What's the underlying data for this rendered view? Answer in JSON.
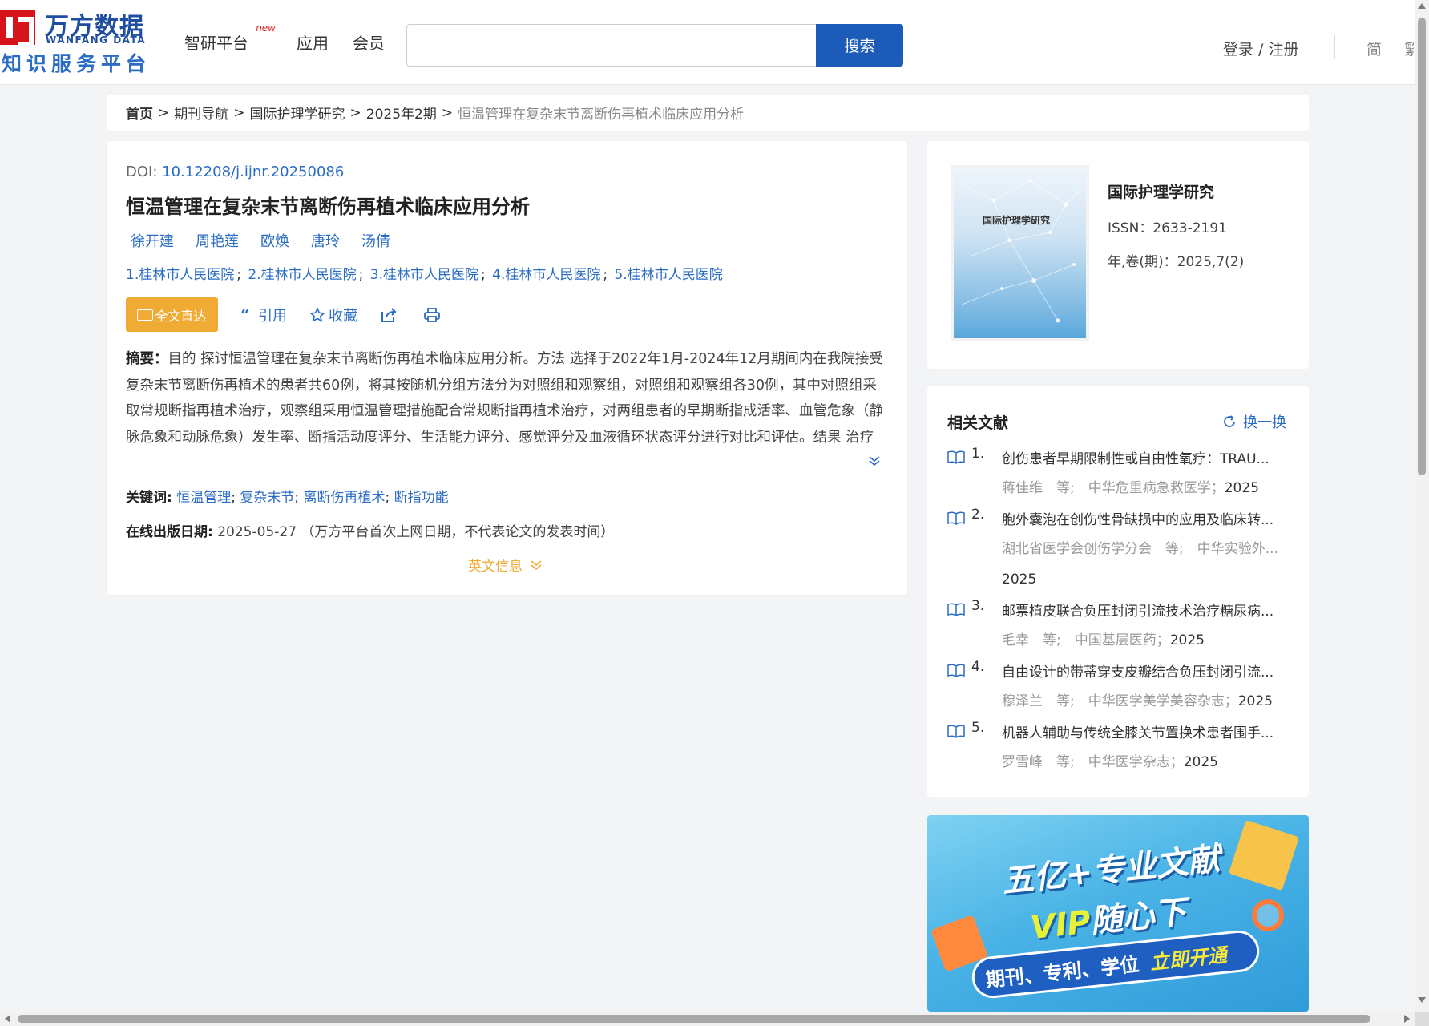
{
  "header": {
    "logo_cn": "万方数据",
    "logo_en": "WANFANG DATA",
    "logo_sub": "知识服务平台",
    "nav": [
      {
        "label": "智研平台",
        "badge": "new"
      },
      {
        "label": "应用"
      },
      {
        "label": "会员"
      }
    ],
    "search_value": "",
    "search_button": "搜索",
    "login": "登录 / 注册",
    "lang_simplified": "简",
    "lang_traditional": "繁"
  },
  "breadcrumb": [
    "首页",
    "期刊导航",
    "国际护理学研究",
    "2025年2期",
    "恒温管理在复杂末节离断伤再植术临床应用分析"
  ],
  "article": {
    "doi_label": "DOI:",
    "doi": "10.12208/j.ijnr.20250086",
    "title": "恒温管理在复杂末节离断伤再植术临床应用分析",
    "authors": [
      "徐开建",
      "周艳莲",
      "欧焕",
      "唐玲",
      "汤倩"
    ],
    "affiliations": [
      "1.桂林市人民医院",
      "2.桂林市人民医院",
      "3.桂林市人民医院",
      "4.桂林市人民医院",
      "5.桂林市人民医院"
    ],
    "actions": {
      "fulltext": "全文直达",
      "cite": "引用",
      "favorite": "收藏"
    },
    "abstract_label": "摘要：",
    "abstract": "目的 探讨恒温管理在复杂末节离断伤再植术临床应用分析。方法 选择于2022年1月-2024年12月期间内在我院接受复杂末节离断伤再植术的患者共60例，将其按随机分组方法分为对照组和观察组，对照组和观察组各30例，其中对照组采取常规断指再植术治疗，观察组采用恒温管理措施配合常规断指再植术治疗，对两组患者的早期断指成活率、血管危象（静脉危象和动脉危象）发生率、断指活动度评分、生活能力评分、感觉评分及血液循环状态评分进行对比和评估。结果 治疗后，观察组和对照组的早期断指成活率差异无统计学意义（P>0.05）。观察组患者的静脉危象和动脉危象发生率均低于...",
    "keywords_label": "关键词:",
    "keywords": [
      "恒温管理",
      "复杂末节",
      "离断伤再植术",
      "断指功能"
    ],
    "pubdate_label": "在线出版日期:",
    "pubdate": "2025-05-27",
    "pubdate_note": "（万方平台首次上网日期，不代表论文的发表时间）",
    "english_info": "英文信息"
  },
  "journal": {
    "cover_title": "国际护理学研究",
    "name": "国际护理学研究",
    "issn": "ISSN：2633-2191",
    "volume": "年,卷(期)：2025,7(2)"
  },
  "related": {
    "title": "相关文献",
    "refresh": "换一换",
    "items": [
      {
        "num": "1.",
        "title": "创伤患者早期限制性或自由性氧疗：TRAU...",
        "meta": "蒋佳维　等;　中华危重病急救医学；",
        "year": "2025"
      },
      {
        "num": "2.",
        "title": "胞外囊泡在创伤性骨缺损中的应用及临床转...",
        "meta": "湖北省医学会创伤学分会　等;　中华实验外...",
        "year": "2025"
      },
      {
        "num": "3.",
        "title": "邮票植皮联合负压封闭引流技术治疗糖尿病...",
        "meta": "毛幸　等;　中国基层医药；",
        "year": "2025"
      },
      {
        "num": "4.",
        "title": "自由设计的带蒂穿支皮瓣结合负压封闭引流...",
        "meta": "穆泽兰　等;　中华医学美学美容杂志；",
        "year": "2025"
      },
      {
        "num": "5.",
        "title": "机器人辅助与传统全膝关节置换术患者围手...",
        "meta": "罗雪峰　等;　中华医学杂志；",
        "year": "2025"
      }
    ]
  },
  "ad": {
    "line1": "五亿+专业文献",
    "vip": "VIP",
    "line2_rest": "随心下",
    "pill": "期刊、专利、学位",
    "open": "立即开通"
  },
  "colors": {
    "brand_red": "#d7141a",
    "brand_blue": "#1d5bb8",
    "link_blue": "#2b6cc4",
    "accent_orange": "#f0ab34"
  }
}
